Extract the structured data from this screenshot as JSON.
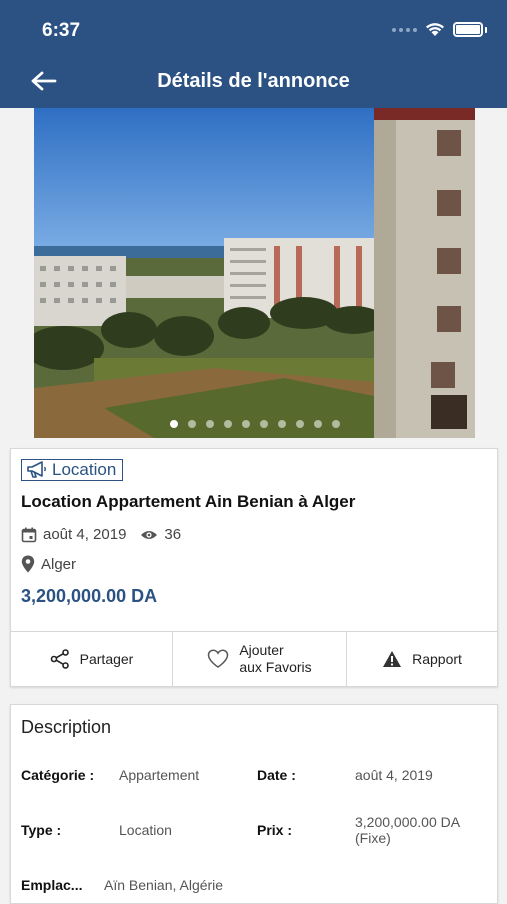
{
  "status_bar": {
    "time": "6:37"
  },
  "header": {
    "title": "Détails de l'annonce"
  },
  "gallery": {
    "image_count": 10,
    "active_index": 0
  },
  "listing": {
    "category_badge": "Location",
    "title": "Location Appartement Ain Benian à Alger",
    "date": "août 4, 2019",
    "views": "36",
    "location": "Alger",
    "price": "3,200,000.00 DA"
  },
  "actions": {
    "share": "Partager",
    "favorite_line1": "Ajouter",
    "favorite_line2": "aux Favoris",
    "report": "Rapport"
  },
  "description": {
    "title": "Description",
    "category_label": "Catégorie :",
    "category_value": "Appartement",
    "date_label": "Date :",
    "date_value": "août 4, 2019",
    "type_label": "Type :",
    "type_value": "Location",
    "price_label": "Prix :",
    "price_value_line1": "3,200,000.00 DA",
    "price_value_line2": "(Fixe)",
    "location_label": "Emplac...",
    "location_value": "Aïn Benian, Algérie"
  },
  "colors": {
    "primary": "#2b5283",
    "background": "#f2f2f2"
  }
}
